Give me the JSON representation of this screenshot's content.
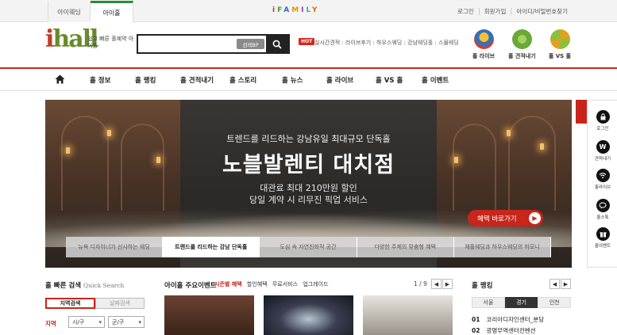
{
  "topbar": {
    "tabs": [
      "아이웨딩",
      "아이홀"
    ],
    "family_logo": "iFAMILY",
    "links": [
      "로그인",
      "회원가입",
      "아이디/비밀번호찾기"
    ]
  },
  "header": {
    "logo_text": "ihall",
    "slogan": "쉽고 빠른 홀예약 아이홀",
    "search": {
      "value": "",
      "dropdown_label": "검색BP",
      "icon": "search-icon"
    },
    "hot_badge": "HOT",
    "hot_links": "실시간견적 : 라이브후기 : 하우스웨딩 : 강남웨딩홀 : 스몰웨딩",
    "quick_links": [
      {
        "label": "홀 라이브",
        "color": "#3a6fb8"
      },
      {
        "label": "홀 견적내기",
        "color": "#6aa83a"
      },
      {
        "label": "홀 VS 홀",
        "color": "#e0a020"
      }
    ]
  },
  "nav": {
    "home_icon": "home-icon",
    "items": [
      "홀 정보",
      "홀 랭킹",
      "홀 견적내기",
      "홀 스토리",
      "홀 뉴스",
      "홀 라이브",
      "홀 VS 홀",
      "홀 이벤트"
    ]
  },
  "hero": {
    "subtitle": "트렌드를 리드하는 강남유일 최대규모 단독홀",
    "title": "노블발렌티 대치점",
    "line1": "대관료 최대 210만원 할인",
    "line2": "당일 계약 시 리무진 픽업 서비스",
    "cta": "혜택 바로가기",
    "tabs": [
      "뉴욕 디자이너가 선사하는 웨딩",
      "트렌드를 리드하는 강남 단독홀",
      "도심 속 자연친화적 공간",
      "다양한 주제의 맞춤형 혜택",
      "채플웨딩과 하우스웨딩의 하모니"
    ],
    "active_tab": 1
  },
  "sticky_menu": [
    {
      "label": "로그인",
      "icon": "lock-icon"
    },
    {
      "label": "견적내기",
      "icon": "won-icon"
    },
    {
      "label": "홀라이브",
      "icon": "wifi-icon"
    },
    {
      "label": "홀스톡",
      "icon": "chat-icon"
    },
    {
      "label": "홀이벤트",
      "icon": "gift-icon"
    }
  ],
  "quick_search": {
    "title": "홀 빠른 검색",
    "title_en": "Quick Search",
    "tabs": [
      "지역검색",
      "날짜검색"
    ],
    "region_label": "지역",
    "city_select": "시/구",
    "district_select": "군/구"
  },
  "events": {
    "title": "아이홀 주요이벤트",
    "tabs": [
      "시즌별 혜택",
      "할인혜택",
      "무료서비스",
      "업그레이드"
    ],
    "page": "1 / 9"
  },
  "ranking": {
    "title": "홀 랭킹",
    "tabs": [
      "서울",
      "경기",
      "인천"
    ],
    "active_tab": 1,
    "rows": [
      {
        "rank": "01",
        "name": "코리아디자인센터_분당"
      },
      {
        "rank": "02",
        "name": "광명무역센터컨벤션"
      }
    ]
  }
}
